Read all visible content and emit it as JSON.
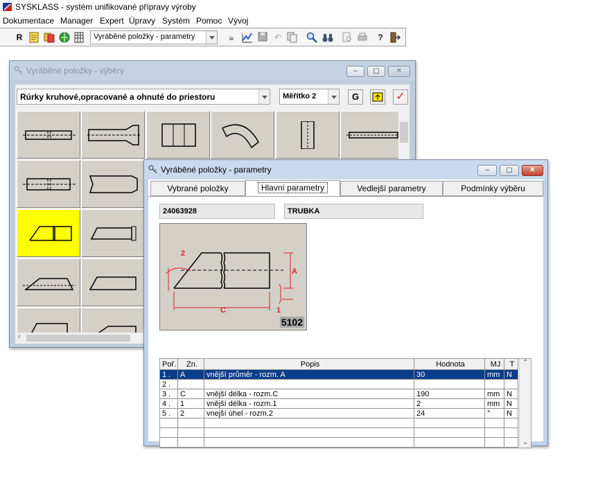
{
  "app": {
    "title": "SYSKLASS - systém unifikované přípravy výroby",
    "accent": "#d02020"
  },
  "menu": [
    "Dokumentace",
    "Manager",
    "Expert",
    "Úpravy",
    "Systém",
    "Pomoc",
    "Vývoj"
  ],
  "toolbar": {
    "r_label": "R",
    "view_combo": "Vyráběné položky - parametry",
    "icons": [
      "document-icon",
      "swap-icon",
      "globe-icon",
      "grid-icon",
      "lock-icon",
      "chart-icon",
      "save-icon",
      "undo-icon",
      "copy-icon",
      "search-icon",
      "binoculars-icon",
      "print-preview-icon",
      "print-icon",
      "help-icon",
      "exit-icon"
    ]
  },
  "win1": {
    "title": "Vyráběné položky - výběry",
    "category": "Rúrky kruhové,opracované a ohnuté do priestoru",
    "scale": "Měřítko 2",
    "g_button": "G",
    "highlight": "#ffff00"
  },
  "win2": {
    "title": "Vyráběné položky - parametry",
    "tabs": [
      "Vybrané položky",
      "Hlavní parametry",
      "Vedlejší parametry",
      "Podmínky výběru"
    ],
    "active_tab": 1,
    "code": "24063928",
    "name": "TRUBKA",
    "drawing": {
      "labels": {
        "angle": "2",
        "diameter": "A",
        "length": "C",
        "dim1": "1"
      },
      "number": "5102"
    },
    "table": {
      "headers": [
        "Poř.",
        "Zn.",
        "Popis",
        "Hodnota",
        "MJ",
        "T"
      ],
      "rows": [
        {
          "no": "1 .",
          "code": "A",
          "desc": "vnější průměr - rozm. A",
          "value": "30",
          "unit": "mm",
          "t": "N"
        },
        {
          "no": "2 .",
          "code": "",
          "desc": "",
          "value": "",
          "unit": "",
          "t": ""
        },
        {
          "no": "3 .",
          "code": "C",
          "desc": "vnější délka - rozm.C",
          "value": "190",
          "unit": "mm",
          "t": "N"
        },
        {
          "no": "4 .",
          "code": "1",
          "desc": "vnější délka - rozm.1",
          "value": "2",
          "unit": "mm",
          "t": "N"
        },
        {
          "no": "5 .",
          "code": "2",
          "desc": "vnejší úhel - rozm.2",
          "value": "24",
          "unit": "°",
          "t": "N"
        }
      ],
      "selected_row": 0
    }
  }
}
